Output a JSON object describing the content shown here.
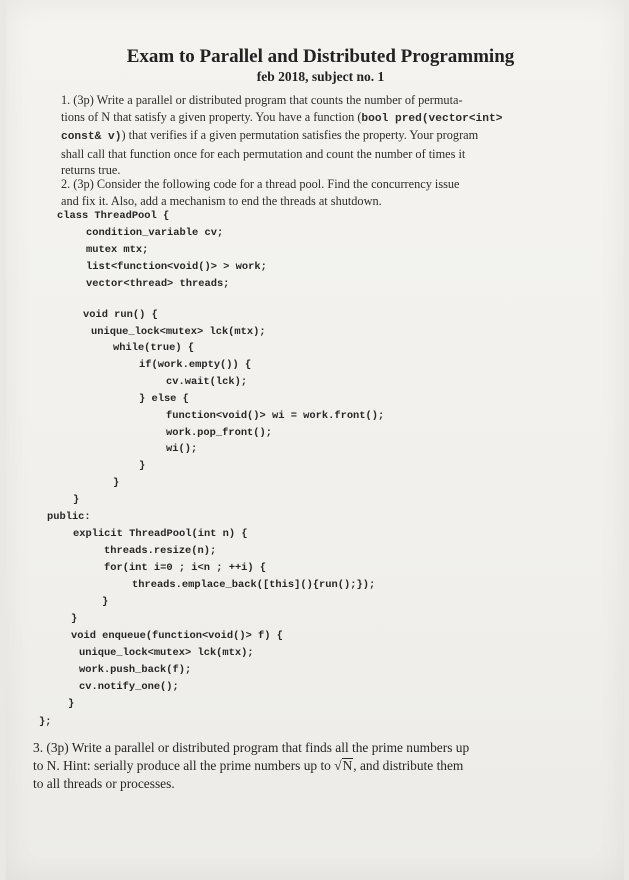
{
  "exam": {
    "title": "Exam to Parallel and Distributed Programming",
    "subtitle": "feb 2018, subject no. 1"
  },
  "q1": {
    "l1": "1. (3p) Write a parallel or distributed program that counts the number of permuta-",
    "l2": "tions of N that satisfy a given property. You have a function (",
    "l2_code": "bool pred(vector<int>",
    "l3_code": "const& v)",
    "l3": ") that verifies if a given permutation satisfies the property. Your program",
    "l4": "shall call that function once for each permutation and count the number of times it",
    "l5": "returns true."
  },
  "q2": {
    "l1": "2. (3p) Consider the following code for a thread pool. Find the concurrency issue",
    "l2": "and fix it. Also, add a mechanism to end the threads at shutdown."
  },
  "code_lines": [
    "class ThreadPool {",
    "condition_variable cv;",
    "mutex mtx;",
    "list<function<void()> > work;",
    "vector<thread> threads;",
    "void run() {",
    "unique_lock<mutex> lck(mtx);",
    "while(true) {",
    "if(work.empty()) {",
    "cv.wait(lck);",
    "} else {",
    "function<void()> wi = work.front();",
    "work.pop_front();",
    "wi();",
    "}",
    "}",
    "}",
    "public:",
    "explicit ThreadPool(int n) {",
    "threads.resize(n);",
    "for(int i=0 ; i<n ; ++i) {",
    "threads.emplace_back([this](){run();});",
    "}",
    "}",
    "void enqueue(function<void()> f) {",
    "unique_lock<mutex> lck(mtx);",
    "work.push_back(f);",
    "cv.notify_one();",
    "}",
    "};"
  ],
  "q3": {
    "l1": "3. (3p) Write a parallel or distributed program that finds all the prime numbers up",
    "l2a": "to N. Hint: serially produce all the prime numbers up to ",
    "l2_sqrt": "N",
    "l2b": ", and distribute them",
    "l3": "to all threads or processes."
  }
}
